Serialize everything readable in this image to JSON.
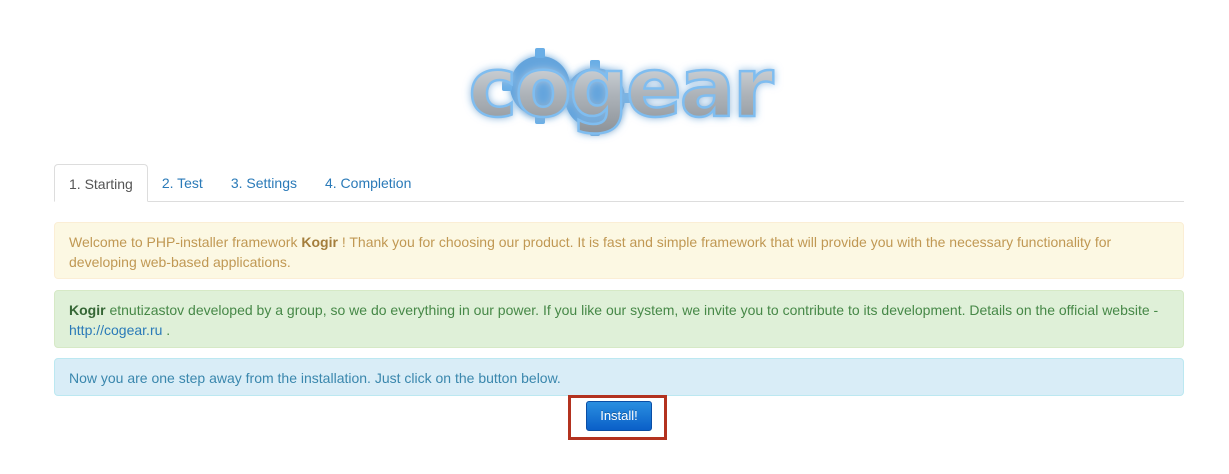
{
  "logo": {
    "text": "cogear"
  },
  "tabs": [
    {
      "label": "1. Starting",
      "active": true
    },
    {
      "label": "2. Test",
      "active": false
    },
    {
      "label": "3. Settings",
      "active": false
    },
    {
      "label": "4. Completion",
      "active": false
    }
  ],
  "alerts": {
    "warning": {
      "prefix": "Welcome to PHP-installer framework ",
      "bold": "Kogir",
      "suffix": " ! Thank you for choosing our product. It is fast and simple framework that will provide you with the necessary functionality for developing web-based applications."
    },
    "success": {
      "bold": "Kogir",
      "text": " etnutizastov developed by a group, so we do everything in our power. If you like our system, we invite you to contribute to its development. Details on the official website - ",
      "link": "http://cogear.ru",
      "suffix": " ."
    },
    "info": {
      "text": "Now you are one step away from the installation. Just click on the button below."
    }
  },
  "install_button": {
    "label": "Install!"
  },
  "colors": {
    "link": "#2a7ab8",
    "highlight": "#b3321f",
    "button": "#0a5fc8"
  }
}
